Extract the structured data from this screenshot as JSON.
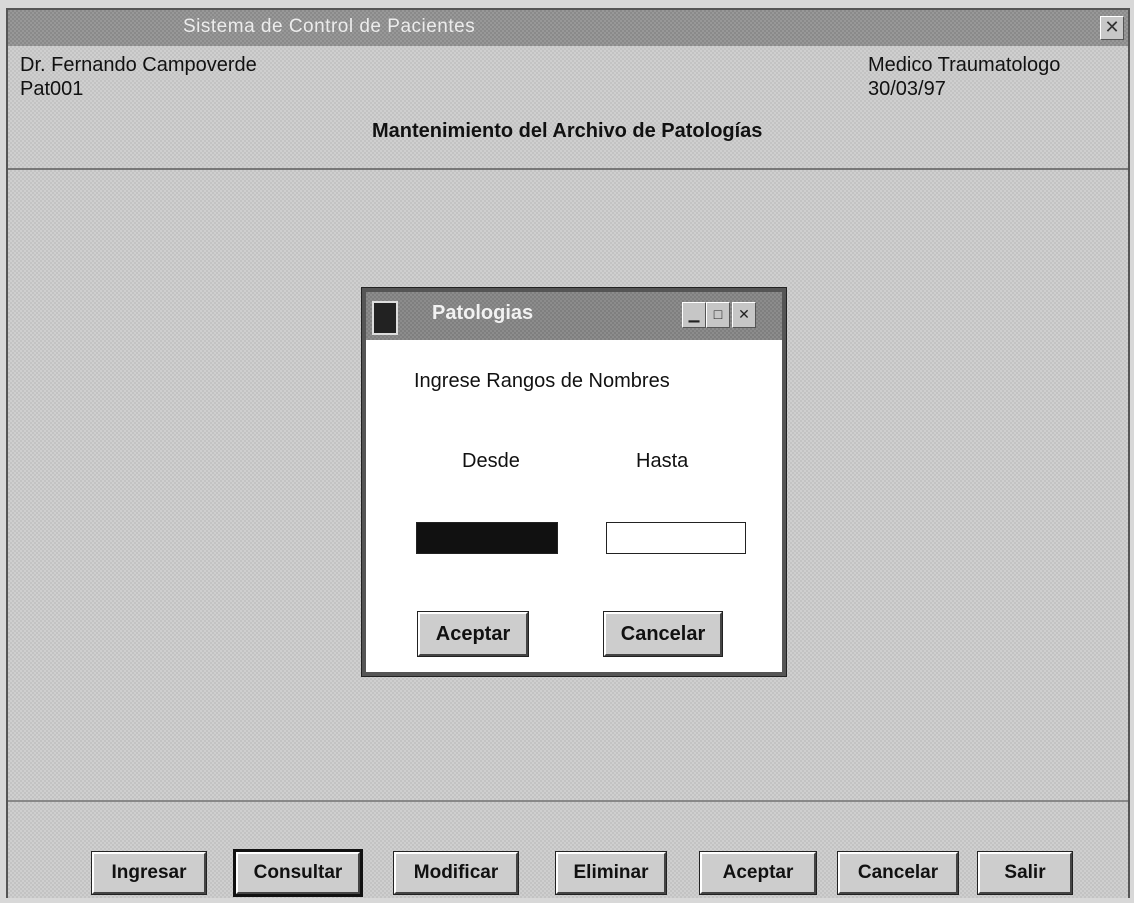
{
  "window": {
    "title": "Sistema de Control de Pacientes"
  },
  "header": {
    "doctor": "Dr. Fernando Campoverde",
    "code": "Pat001",
    "specialty": "Medico Traumatologo",
    "date": "30/03/97",
    "screen_title": "Mantenimiento del Archivo de Patologías"
  },
  "dialog": {
    "title": "Patologias",
    "prompt": "Ingrese Rangos de Nombres",
    "from_label": "Desde",
    "to_label": "Hasta",
    "from_value": "",
    "to_value": "",
    "accept_label": "Aceptar",
    "cancel_label": "Cancelar"
  },
  "toolbar": {
    "buttons": [
      {
        "label": "Ingresar"
      },
      {
        "label": "Consultar"
      },
      {
        "label": "Modificar"
      },
      {
        "label": "Eliminar"
      },
      {
        "label": "Aceptar"
      },
      {
        "label": "Cancelar"
      },
      {
        "label": "Salir"
      }
    ]
  },
  "icons": {
    "close": "close-icon",
    "minimize": "minimize-icon",
    "maximize": "maximize-icon",
    "app": "app-icon"
  }
}
